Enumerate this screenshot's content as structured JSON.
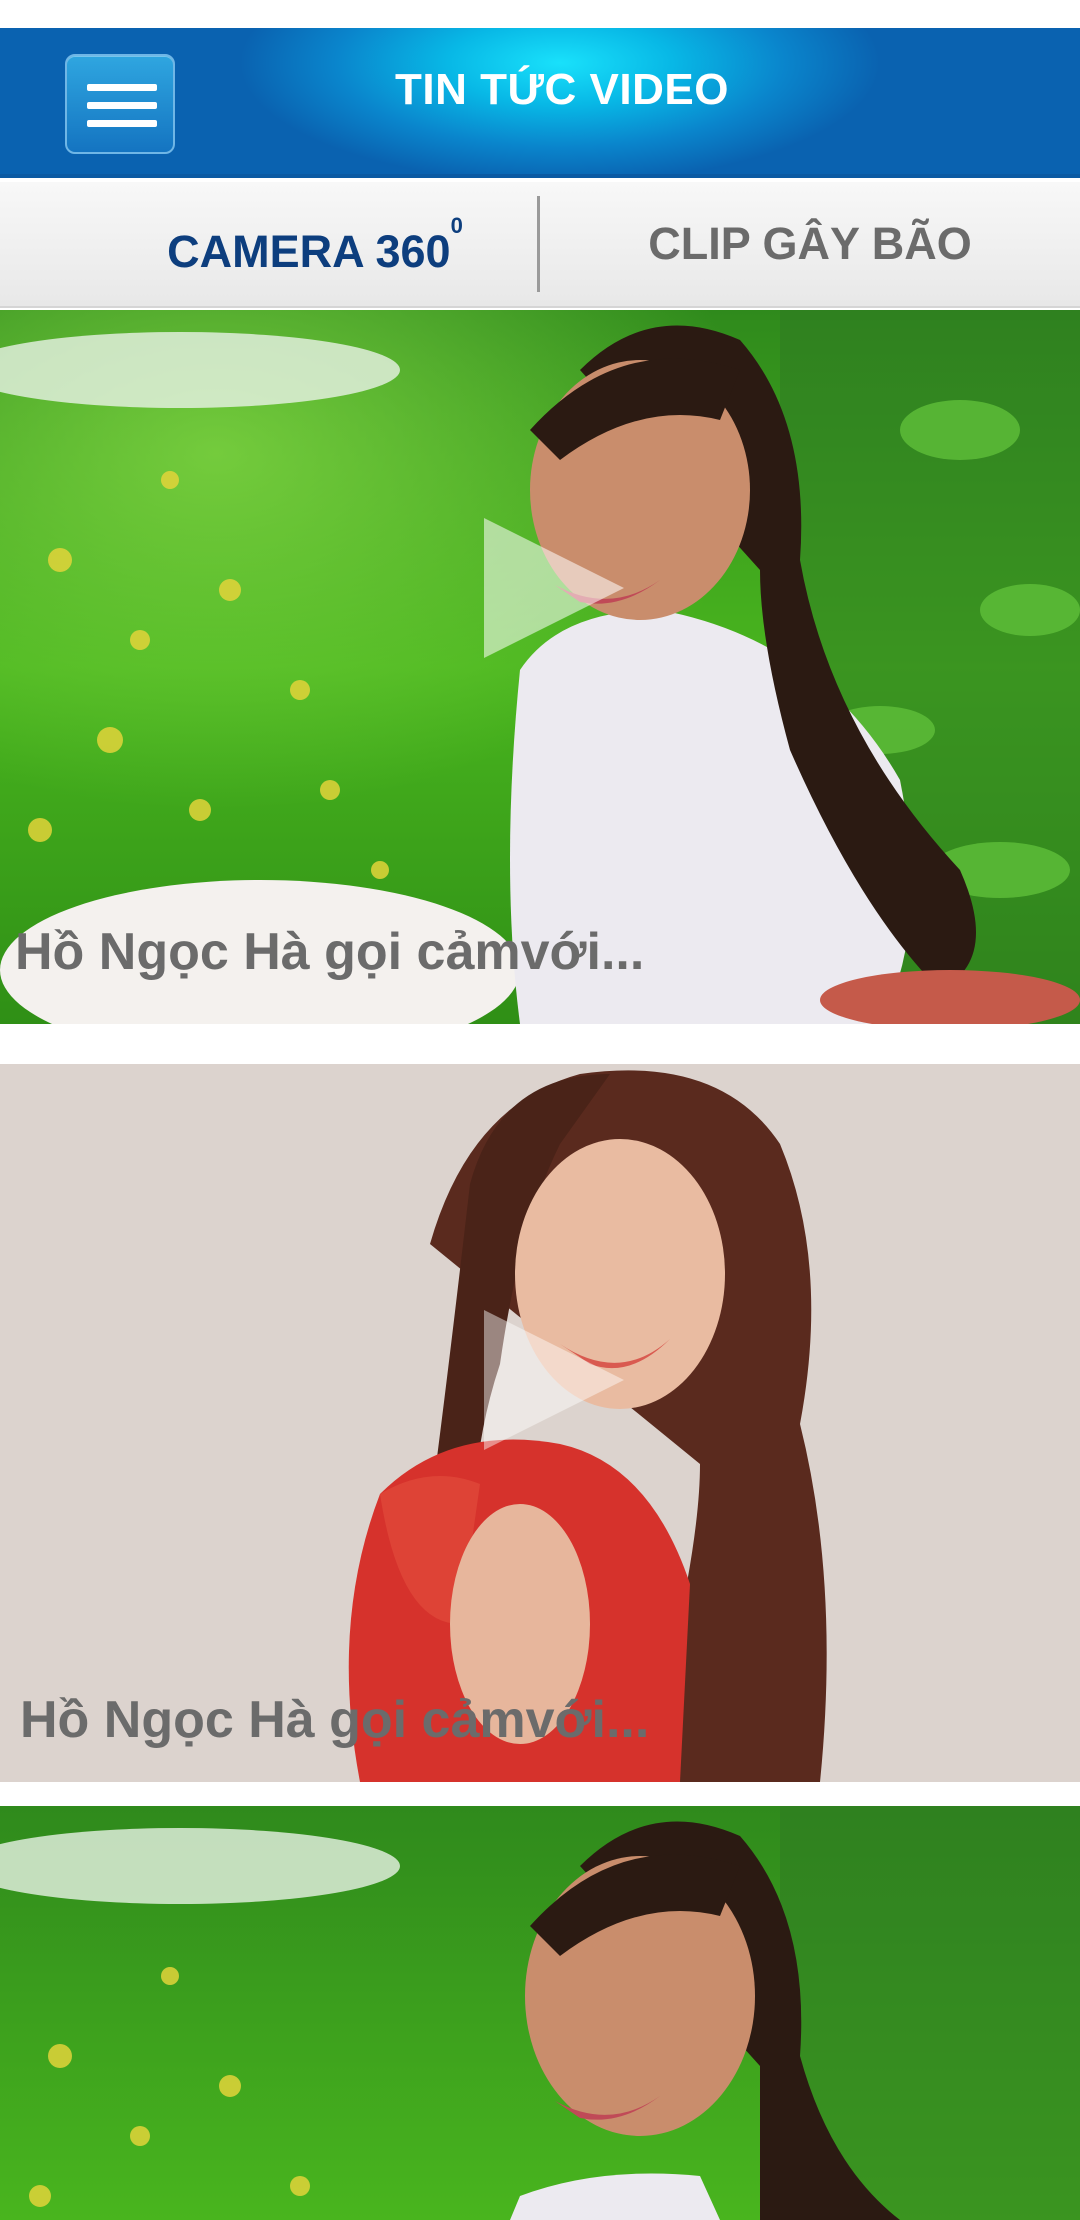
{
  "header": {
    "title": "TIN TỨC VIDEO",
    "menu_icon": "hamburger-menu-icon"
  },
  "tabs": {
    "camera": {
      "label": "CAMERA 360",
      "superscript": "0"
    },
    "clip": {
      "label": "CLIP GÂY BÃO"
    }
  },
  "videos": [
    {
      "title": "Hồ Ngọc Hà gọi cảmvới...",
      "play_icon": "play-icon"
    },
    {
      "title": "Hồ Ngọc Hà gọi cảmvới...",
      "play_icon": "play-icon"
    },
    {
      "title": "",
      "play_icon": ""
    }
  ],
  "colors": {
    "header_accent": "#08b8e6",
    "active_tab": "#0d3e7e",
    "inactive_tab": "#6b6b6b",
    "caption": "#6b6b6b"
  }
}
